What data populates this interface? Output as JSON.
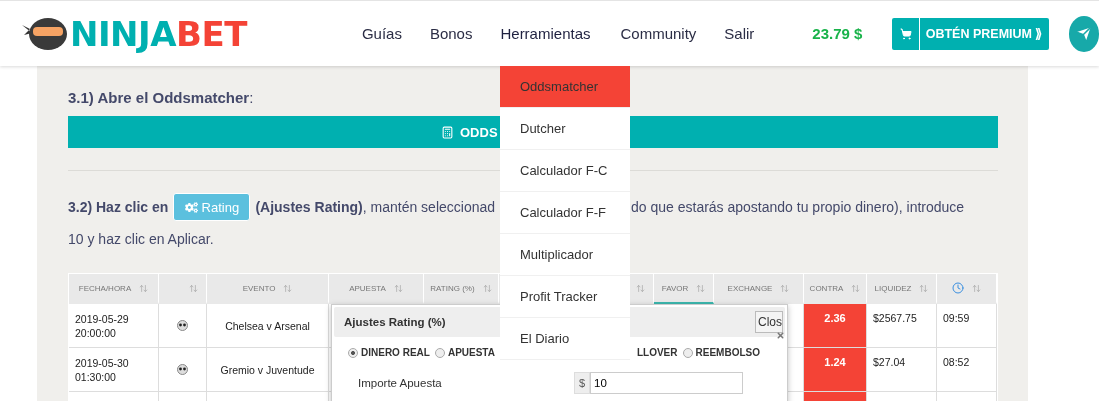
{
  "logo": {
    "text": "NINJA",
    "accent": "BET"
  },
  "nav": [
    {
      "label": "Guías",
      "expanded": false
    },
    {
      "label": "Bonos",
      "expanded": false
    },
    {
      "label": "Herramientas",
      "expanded": true
    },
    {
      "label": "Community",
      "expanded": false
    },
    {
      "label": "Salir",
      "expanded": false
    }
  ],
  "balance": "23.79 $",
  "premium_button": "OBTÉN PREMIUM ⟫",
  "tools_menu": [
    {
      "label": "Oddsmatcher",
      "selected": true
    },
    {
      "label": "Dutcher",
      "selected": false
    },
    {
      "label": "Calculador F-C",
      "selected": false
    },
    {
      "label": "Calculador F-F",
      "selected": false
    },
    {
      "label": "Multiplicador",
      "selected": false
    },
    {
      "label": "Profit Tracker",
      "selected": false
    },
    {
      "label": "El Diario",
      "selected": false
    }
  ],
  "step1": {
    "heading": "**3.1) Abre el Oddsmatcher**:",
    "button": "ODDS"
  },
  "step2": {
    "intro": "3.2) Haz clic en",
    "button": "Rating",
    "text_before": "**(Ajustes Rating)**, mantén seleccionad",
    "text_after": "do que estarás apostando tu propio dinero), introduce",
    "line2": "10 y haz clic en Aplicar."
  },
  "table": {
    "columns": [
      {
        "kind": "text",
        "label": "FECHA/HORA",
        "selected": false
      },
      {
        "kind": "blank",
        "selected": false
      },
      {
        "kind": "text",
        "label": "EVENTO",
        "selected": false
      },
      {
        "kind": "text",
        "label": "APUESTA",
        "selected": false
      },
      {
        "kind": "text",
        "label": "RATING (%)",
        "selected": false
      },
      {
        "kind": "blank",
        "selected": false
      },
      {
        "kind": "text",
        "label": "FAVOR",
        "selected": true
      },
      {
        "kind": "text",
        "label": "EXCHANGE",
        "selected": false
      },
      {
        "kind": "text",
        "label": "CONTRA",
        "selected": false
      },
      {
        "kind": "text",
        "label": "LIQUIDEZ",
        "selected": false
      },
      {
        "kind": "clock",
        "selected": false
      }
    ],
    "rows": [
      {
        "kind": "full",
        "date": "2019-05-29",
        "time": "20:00:00",
        "event": "Chelsea v Arsenal",
        "contra": "2.36",
        "liquidez": "$2567.75",
        "updated": "09:59"
      },
      {
        "kind": "full",
        "date": "2019-05-30",
        "time": "01:30:00",
        "event": "Gremio v Juventude",
        "contra": "1.24",
        "liquidez": "$27.04",
        "updated": "08:52"
      },
      {
        "kind": "cut"
      }
    ]
  },
  "modal": {
    "title": "Ajustes Rating (%)",
    "close": "Clos",
    "options": [
      {
        "kind": "radio",
        "label": "DINERO REAL",
        "selected": true
      },
      {
        "kind": "radio",
        "label": "APUESTA",
        "selected": false
      },
      {
        "kind": "cut",
        "label": "LLOVER"
      },
      {
        "kind": "radio",
        "label": "REEMBOLSO",
        "selected": false
      }
    ],
    "amount_label": "Importe Apuesta",
    "currency": "$",
    "amount": "10"
  }
}
